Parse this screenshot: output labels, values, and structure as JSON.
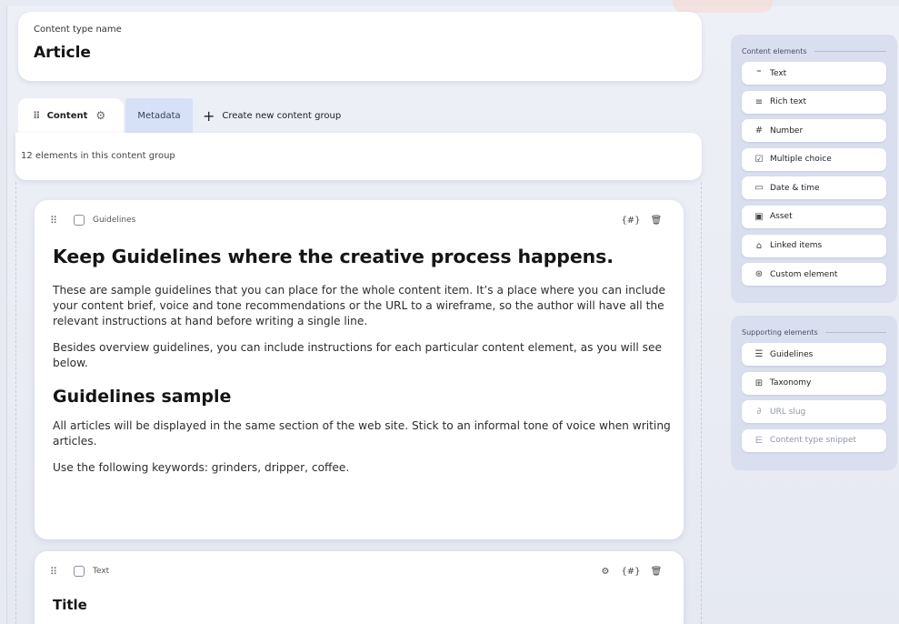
{
  "content_type": {
    "label": "Content type name",
    "name": "Article"
  },
  "tabs": {
    "content": "Content",
    "metadata": "Metadata",
    "create_new": "Create new content group"
  },
  "group_info": "12 elements in this content group",
  "elements": [
    {
      "type": "Guidelines",
      "heading": "Keep Guidelines where the creative process happens.",
      "para1": "These are sample guidelines that you can place for the whole content item. It’s a place where you can include your content brief, voice and tone recommendations or the URL to a wireframe, so the author will have all the relevant instructions at hand before writing a single line.",
      "para2": "Besides overview guidelines, you can include instructions for each particular content element, as you will see below.",
      "subheading": "Guidelines sample",
      "para3": "All articles will be displayed in the same section of the web site. Stick to an informal tone of voice when writing articles.",
      "para4": "Use the following keywords: grinders, dripper, coffee."
    },
    {
      "type": "Text",
      "title": "Title"
    }
  ],
  "sidebar": {
    "content_elements_title": "Content elements",
    "content_elements": [
      {
        "label": "Text",
        "icon": "text-icon"
      },
      {
        "label": "Rich text",
        "icon": "rich-text-icon"
      },
      {
        "label": "Number",
        "icon": "hash-icon"
      },
      {
        "label": "Multiple choice",
        "icon": "checkbox-icon"
      },
      {
        "label": "Date & time",
        "icon": "calendar-icon"
      },
      {
        "label": "Asset",
        "icon": "image-icon"
      },
      {
        "label": "Linked items",
        "icon": "linked-items-icon"
      },
      {
        "label": "Custom element",
        "icon": "custom-element-icon"
      }
    ],
    "supporting_elements_title": "Supporting elements",
    "supporting_elements": [
      {
        "label": "Guidelines",
        "icon": "guidelines-icon"
      },
      {
        "label": "Taxonomy",
        "icon": "taxonomy-icon"
      },
      {
        "label": "URL slug",
        "icon": "link-icon"
      },
      {
        "label": "Content type snippet",
        "icon": "snippet-icon"
      }
    ]
  }
}
